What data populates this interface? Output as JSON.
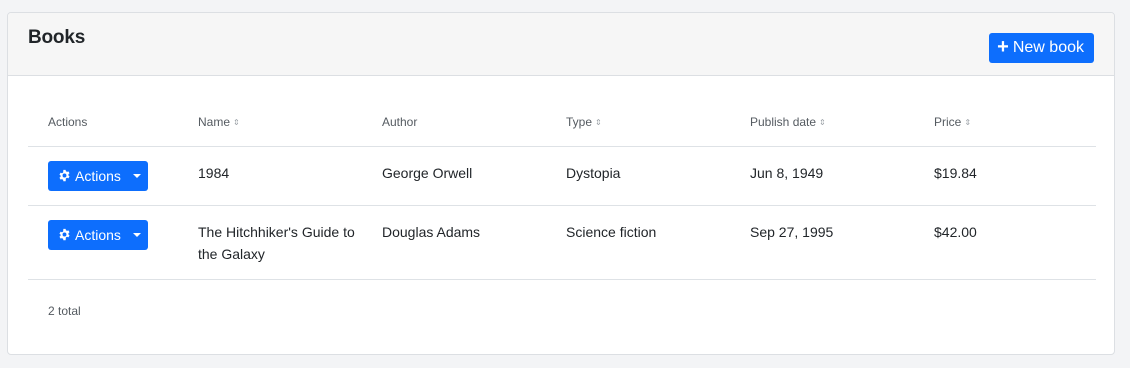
{
  "header": {
    "title": "Books",
    "new_button_label": "New book"
  },
  "table": {
    "columns": [
      {
        "label": "Actions",
        "sortable": false
      },
      {
        "label": "Name",
        "sortable": true
      },
      {
        "label": "Author",
        "sortable": false
      },
      {
        "label": "Type",
        "sortable": true
      },
      {
        "label": "Publish date",
        "sortable": true
      },
      {
        "label": "Price",
        "sortable": true
      }
    ],
    "rows": [
      {
        "action_label": "Actions",
        "name": "1984",
        "author": "George Orwell",
        "type": "Dystopia",
        "publish_date": "Jun 8, 1949",
        "price": "$19.84"
      },
      {
        "action_label": "Actions",
        "name": "The Hitchhiker's Guide to the Galaxy",
        "author": "Douglas Adams",
        "type": "Science fiction",
        "publish_date": "Sep 27, 1995",
        "price": "$42.00"
      }
    ]
  },
  "footer": {
    "total_text": "2 total"
  },
  "colors": {
    "primary": "#0d6efd",
    "header_bg": "#f6f6f6",
    "page_bg": "#f3f4f6"
  },
  "icons": {
    "new": "plus-icon",
    "actions": "gear-icon",
    "dropdown": "caret-down-icon",
    "sort": "sort-icon"
  }
}
